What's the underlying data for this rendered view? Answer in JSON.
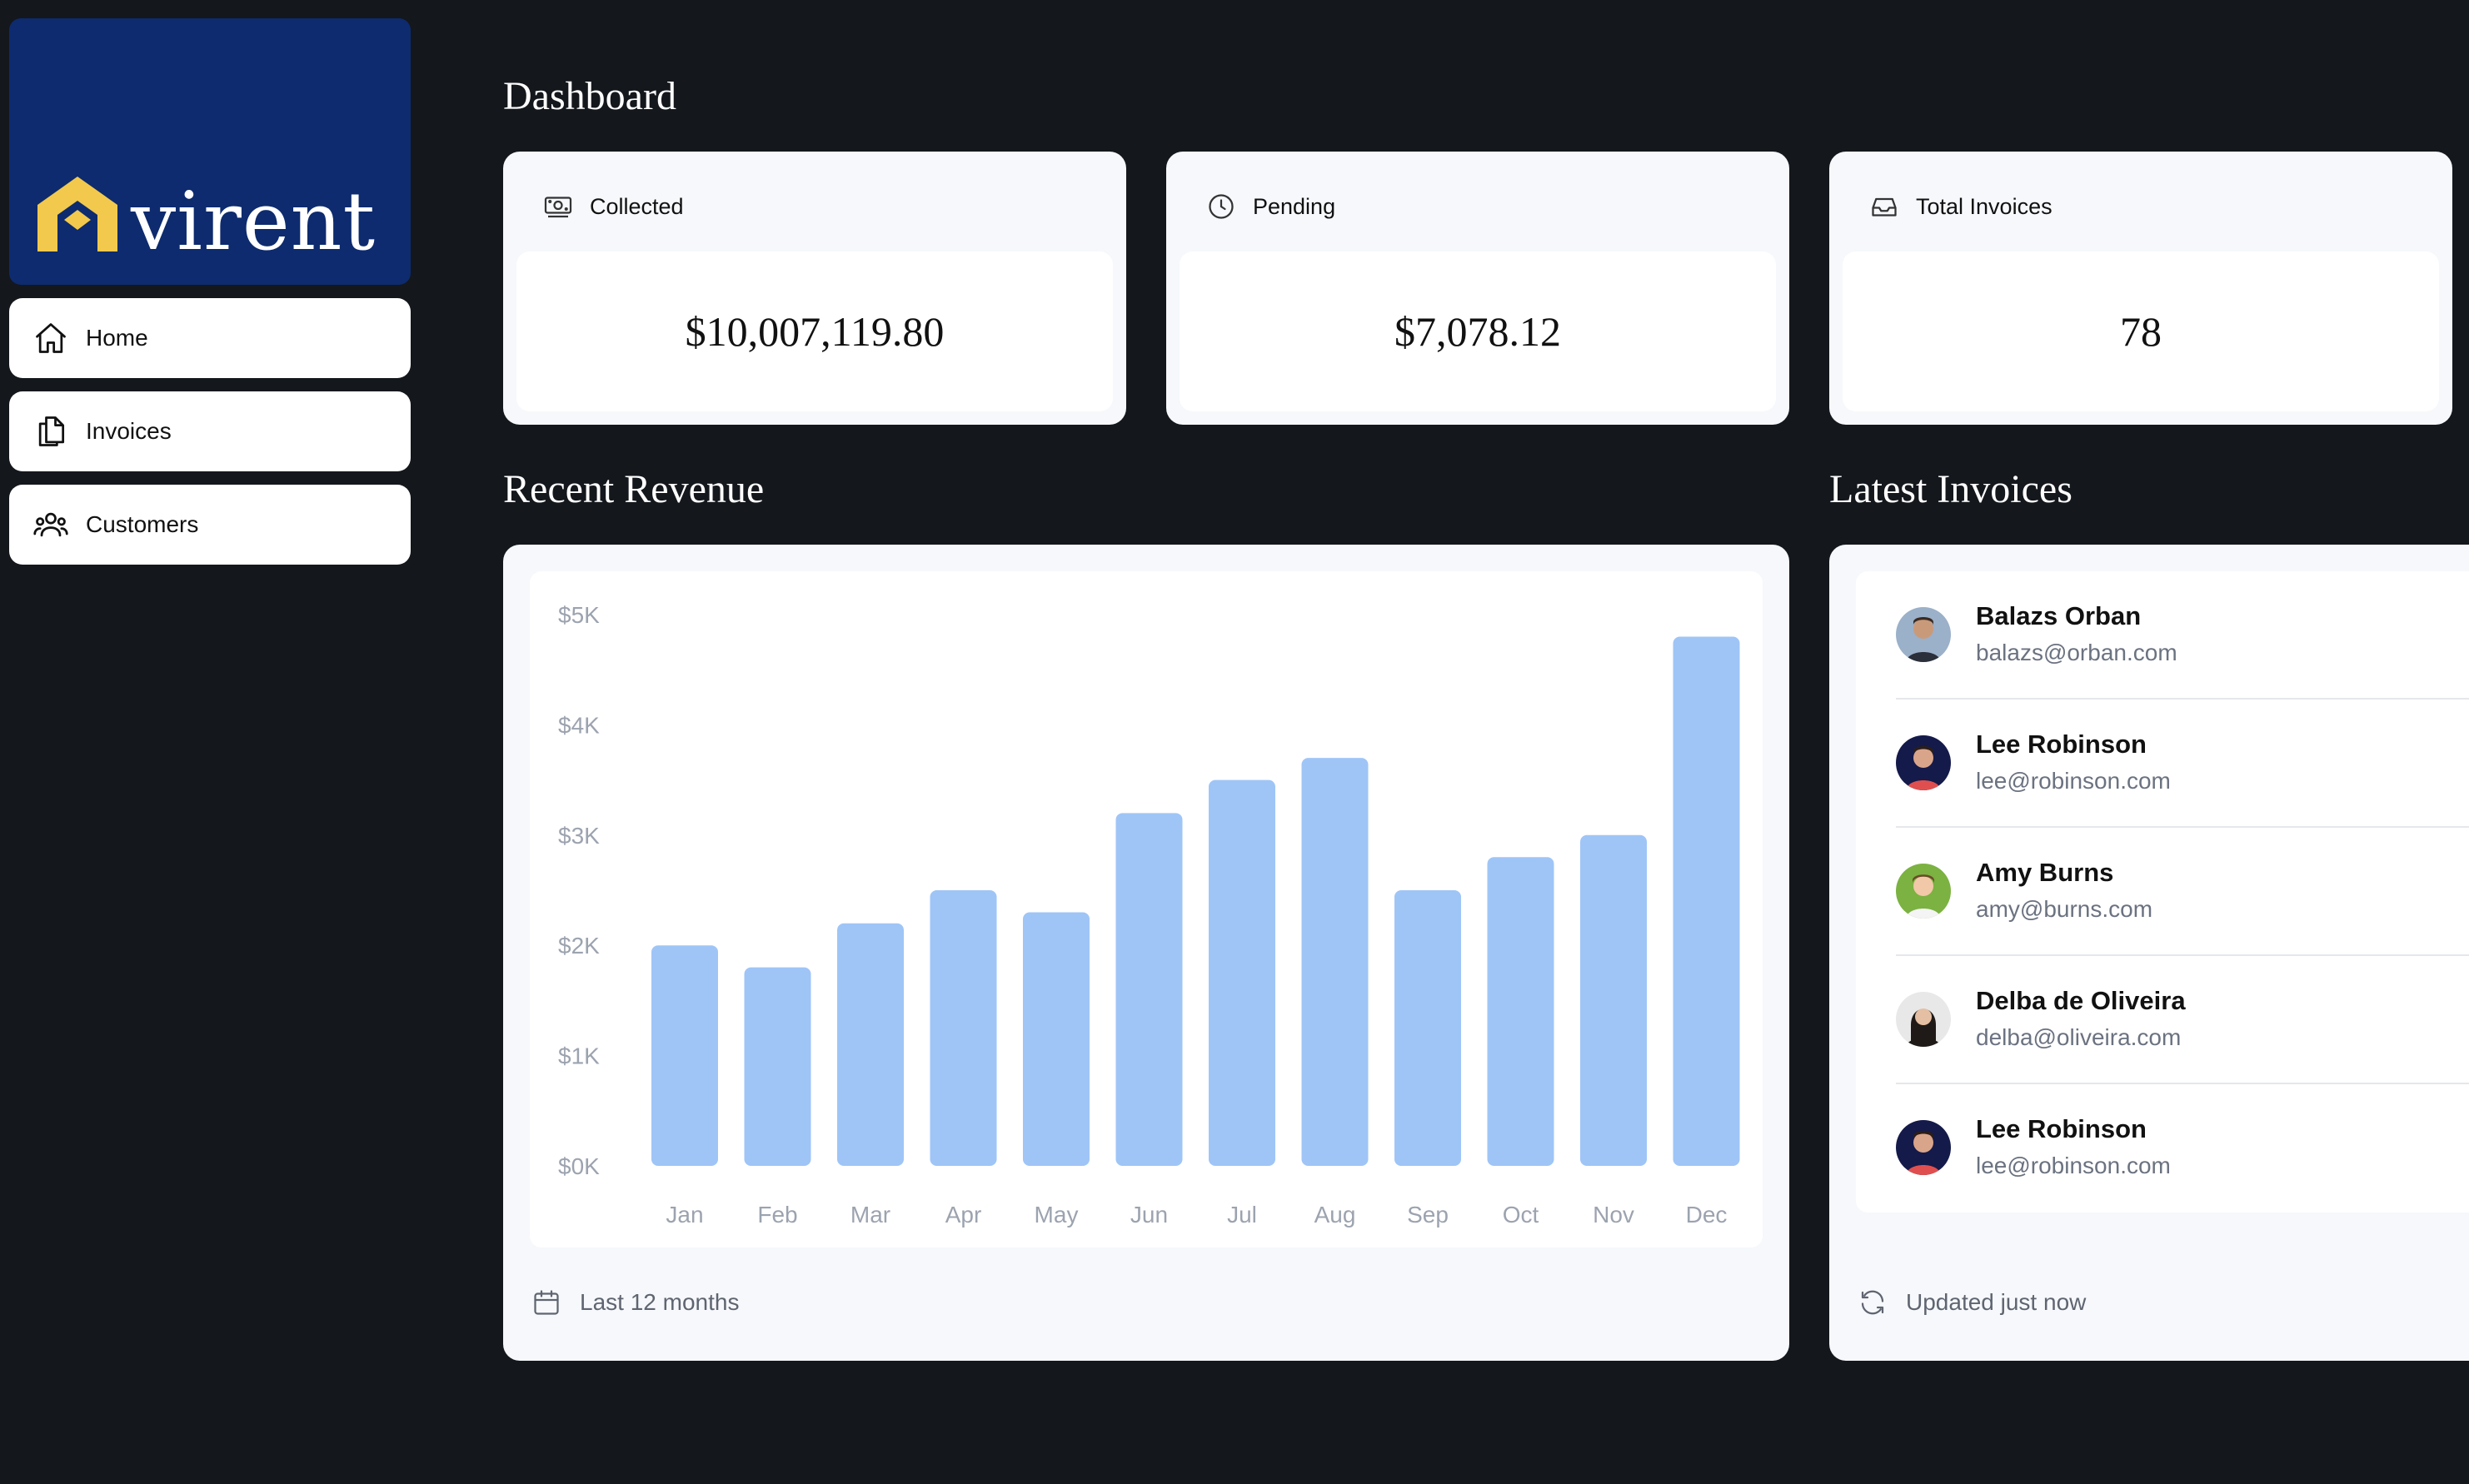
{
  "brand": {
    "name": "virent",
    "primary_color": "#0d2b6e",
    "mark_color": "#f2c94c"
  },
  "sidebar": {
    "items": [
      {
        "label": "Home",
        "icon": "home-icon"
      },
      {
        "label": "Invoices",
        "icon": "document-duplicate-icon"
      },
      {
        "label": "Customers",
        "icon": "user-group-icon"
      }
    ]
  },
  "main": {
    "title": "Dashboard",
    "stats": [
      {
        "label": "Collected",
        "value": "$10,007,119.80",
        "icon": "banknotes-icon"
      },
      {
        "label": "Pending",
        "value": "$7,078.12",
        "icon": "clock-icon"
      },
      {
        "label": "Total Invoices",
        "value": "78",
        "icon": "inbox-icon"
      }
    ],
    "revenue": {
      "title": "Recent Revenue",
      "footer": "Last 12 months",
      "footer_icon": "calendar-icon"
    },
    "latest": {
      "title": "Latest Invoices",
      "footer": "Updated just now",
      "footer_icon": "refresh-icon",
      "items": [
        {
          "name": "Balazs Orban",
          "email": "balazs@orban.com"
        },
        {
          "name": "Lee Robinson",
          "email": "lee@robinson.com"
        },
        {
          "name": "Amy Burns",
          "email": "amy@burns.com"
        },
        {
          "name": "Delba de Oliveira",
          "email": "delba@oliveira.com"
        },
        {
          "name": "Lee Robinson",
          "email": "lee@robinson.com"
        }
      ]
    }
  },
  "chart_data": {
    "type": "bar",
    "categories": [
      "Jan",
      "Feb",
      "Mar",
      "Apr",
      "May",
      "Jun",
      "Jul",
      "Aug",
      "Sep",
      "Oct",
      "Nov",
      "Dec"
    ],
    "values": [
      2000,
      1800,
      2200,
      2500,
      2300,
      3200,
      3500,
      3700,
      2500,
      2800,
      3000,
      4800
    ],
    "y_ticks": [
      "$0K",
      "$1K",
      "$2K",
      "$3K",
      "$4K",
      "$5K"
    ],
    "ylim": [
      0,
      5000
    ],
    "bar_color": "#9fc5f7",
    "tick_color": "#9ca3af"
  }
}
